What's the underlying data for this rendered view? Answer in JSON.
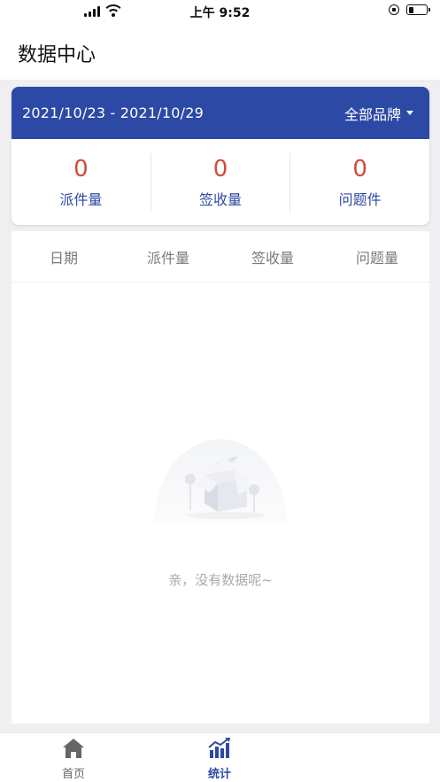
{
  "status_bar": {
    "time": "上午 9:52"
  },
  "header": {
    "title": "数据中心"
  },
  "summary": {
    "date_range": "2021/10/23 - 2021/10/29",
    "brand_filter": "全部品牌",
    "metrics": [
      {
        "value": "0",
        "label": "派件量"
      },
      {
        "value": "0",
        "label": "签收量"
      },
      {
        "value": "0",
        "label": "问题件"
      }
    ]
  },
  "table": {
    "columns": [
      "日期",
      "派件量",
      "签收量",
      "问题量"
    ],
    "empty_text": "亲，没有数据呢~"
  },
  "tab_bar": {
    "tabs": [
      {
        "label": "首页",
        "icon": "home-icon",
        "active": false
      },
      {
        "label": "统计",
        "icon": "bar-chart-icon",
        "active": true
      }
    ]
  },
  "colors": {
    "primary": "#2d49a6",
    "metric_value": "#d24a3a",
    "background": "#efeff1"
  }
}
